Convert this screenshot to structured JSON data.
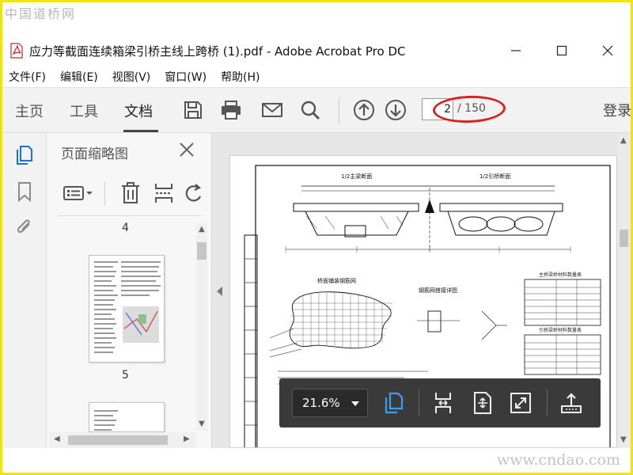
{
  "watermarks": {
    "top": "中国道桥网",
    "bottom": "www.cndao.com"
  },
  "window": {
    "title": "应力等截面连续箱梁引桥主线上跨桥 (1).pdf - Adobe Acrobat Pro DC",
    "controls": [
      "minimize",
      "maximize",
      "close"
    ]
  },
  "menu": {
    "items": [
      "文件(F)",
      "编辑(E)",
      "视图(V)",
      "窗口(W)",
      "帮助(H)"
    ]
  },
  "toolbar": {
    "tabs": [
      "主页",
      "工具",
      "文档"
    ],
    "active_tab": "文档",
    "icons": [
      "save-icon",
      "print-icon",
      "email-icon",
      "search-icon",
      "page-up-icon",
      "page-down-icon"
    ],
    "page_current": "2",
    "page_total": "/ 150",
    "signin": "登录"
  },
  "rail": {
    "icons": [
      "page-thumbnails-icon",
      "bookmark-icon",
      "attachment-icon"
    ]
  },
  "panel": {
    "title": "页面缩略图",
    "tools": [
      "thumbnail-options-icon",
      "delete-page-icon",
      "crop-page-icon",
      "rotate-page-icon"
    ],
    "thumbnails": [
      {
        "label": "4"
      },
      {
        "label": "5"
      }
    ]
  },
  "document": {
    "drawing_titles": [
      "1/2主梁断面",
      "1/2引桥断面"
    ],
    "detail_titles": [
      "桥面铺装钢筋网",
      "钢筋网搭接详图"
    ],
    "table_titles": [
      "主桥梁桥材料数量表",
      "引桥梁桥材料数量表"
    ]
  },
  "floatbar": {
    "zoom": "21.6%",
    "icons": [
      "single-page-icon",
      "fit-width-icon",
      "fit-page-icon",
      "full-screen-icon",
      "share-icon"
    ]
  },
  "colors": {
    "accent_blue": "#1a73d9",
    "annotation_red": "#d92323",
    "frame_yellow": "#f2e600",
    "floatbar_bg": "#3a3a3a"
  }
}
